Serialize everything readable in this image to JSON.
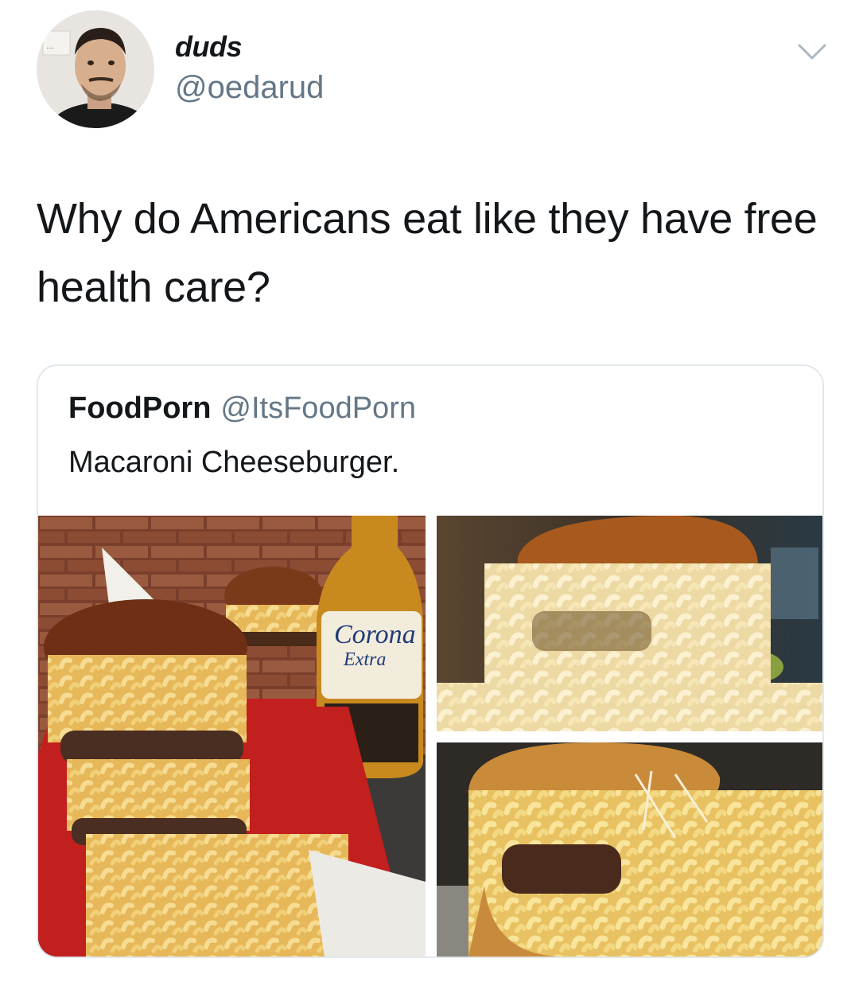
{
  "user": {
    "display_name": "duds",
    "handle": "@oedarud"
  },
  "tweet": {
    "text": "Why do Americans eat like they have free health care?"
  },
  "quoted_tweet": {
    "display_name": "FoodPorn",
    "handle": "@ItsFoodPorn",
    "text": "Macaroni Cheeseburger."
  },
  "photos": [
    {
      "alt": "macaroni cheeseburger in red basket with Corona beer"
    },
    {
      "alt": "macaroni cheeseburger close-up"
    },
    {
      "alt": "macaroni cheeseburger with parmesan"
    }
  ],
  "colors": {
    "text": "#14171a",
    "secondary_text": "#657786",
    "card_border": "#e1e8ed"
  },
  "icons": {
    "menu": "chevron-down-icon"
  }
}
